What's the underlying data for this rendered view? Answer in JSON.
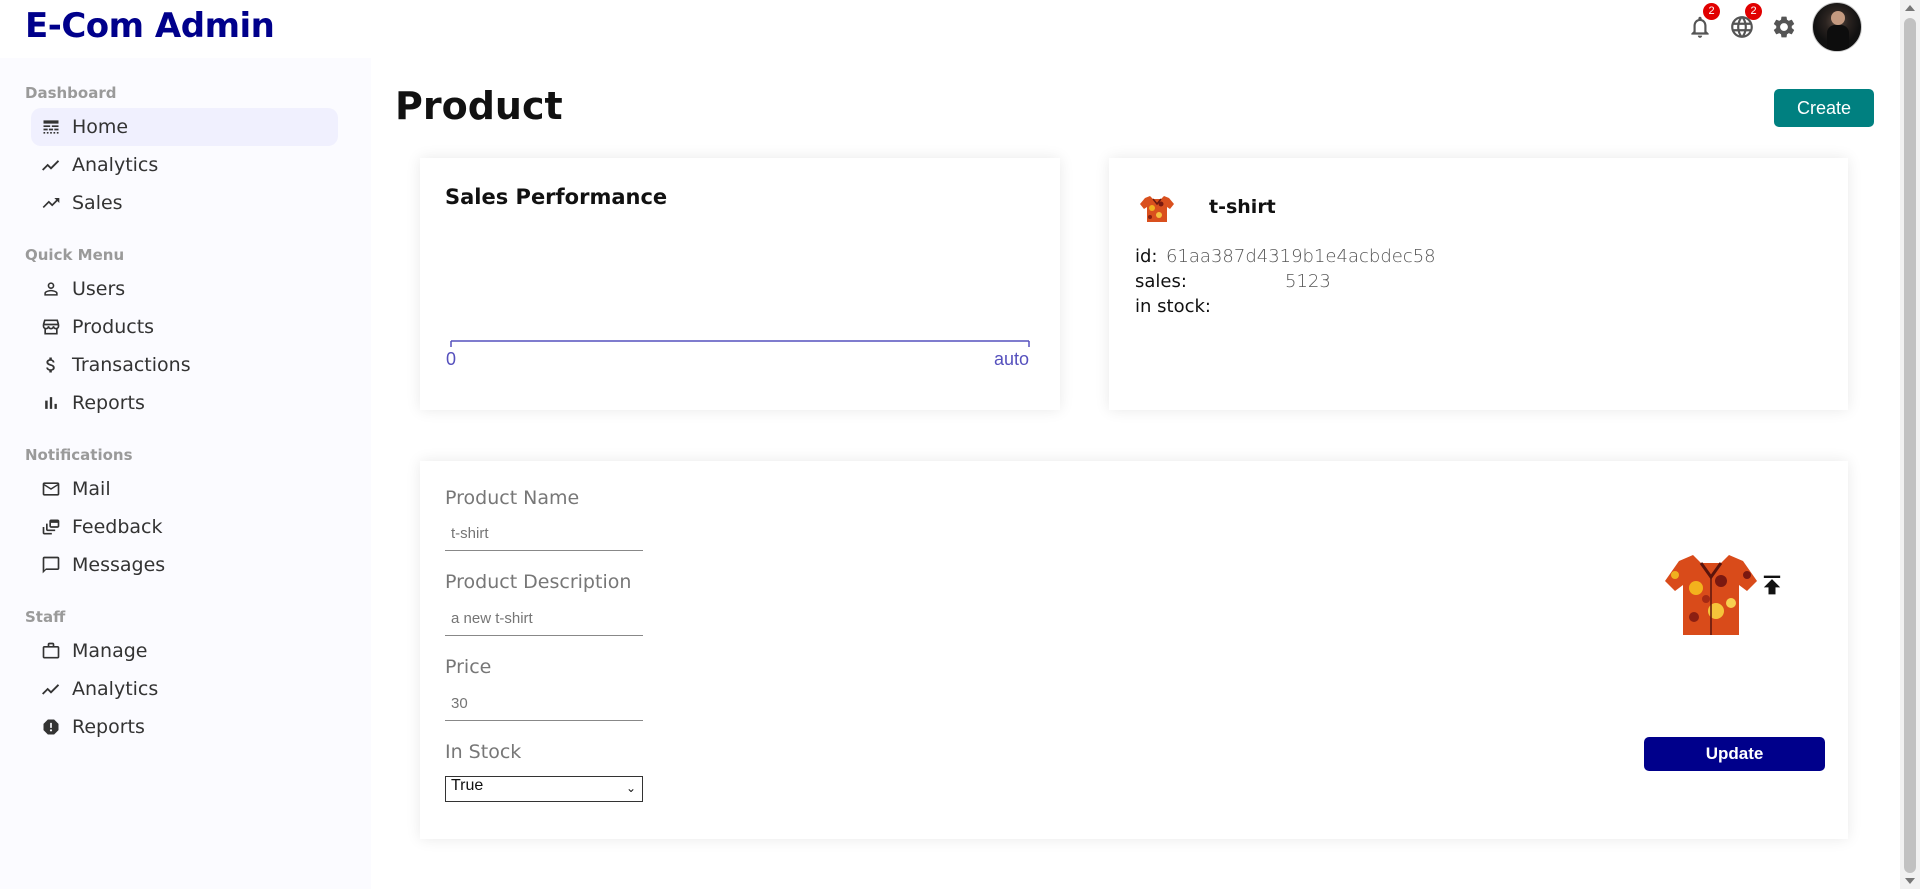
{
  "app": {
    "title": "E-Com Admin"
  },
  "topbar": {
    "notifications_badge": "2",
    "language_badge": "2"
  },
  "sidebar": {
    "sections": [
      {
        "title": "Dashboard",
        "items": [
          {
            "label": "Home",
            "icon": "line-style-icon",
            "active": true
          },
          {
            "label": "Analytics",
            "icon": "timeline-icon"
          },
          {
            "label": "Sales",
            "icon": "trending-up-icon"
          }
        ]
      },
      {
        "title": "Quick Menu",
        "items": [
          {
            "label": "Users",
            "icon": "person-outline-icon"
          },
          {
            "label": "Products",
            "icon": "storefront-icon"
          },
          {
            "label": "Transactions",
            "icon": "dollar-icon"
          },
          {
            "label": "Reports",
            "icon": "bar-chart-icon"
          }
        ]
      },
      {
        "title": "Notifications",
        "items": [
          {
            "label": "Mail",
            "icon": "mail-outline-icon"
          },
          {
            "label": "Feedback",
            "icon": "dynamic-feed-icon"
          },
          {
            "label": "Messages",
            "icon": "chat-bubble-outline-icon"
          }
        ]
      },
      {
        "title": "Staff",
        "items": [
          {
            "label": "Manage",
            "icon": "work-outline-icon"
          },
          {
            "label": "Analytics",
            "icon": "timeline-icon"
          },
          {
            "label": "Reports",
            "icon": "report-icon"
          }
        ]
      }
    ]
  },
  "main": {
    "title": "Product",
    "create_label": "Create",
    "chart": {
      "title": "Sales Performance"
    },
    "info": {
      "name": "t-shirt",
      "id_label": "id:",
      "id_value": "61aa387d4319b1e4acbdec58",
      "sales_label": "sales:",
      "sales_value": "5123",
      "stock_label": "in stock:",
      "stock_value": ""
    },
    "form": {
      "name_label": "Product Name",
      "name_value": "t-shirt",
      "desc_label": "Product Description",
      "desc_value": "a new t-shirt",
      "price_label": "Price",
      "price_value": "30",
      "stock_label": "In Stock",
      "stock_value": "True",
      "update_label": "Update"
    }
  },
  "chart_data": {
    "type": "line",
    "title": "Sales Performance",
    "x": [],
    "series": [],
    "tick_labels": [
      "0",
      "auto"
    ],
    "color": "#5550bd"
  }
}
